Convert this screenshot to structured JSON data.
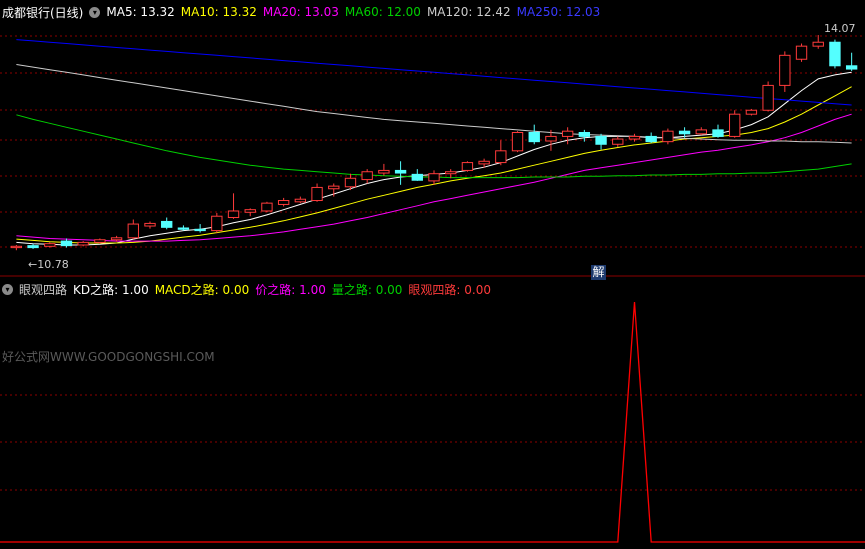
{
  "main_header": {
    "stock": "成都银行(日线)",
    "ma5": "MA5: 13.32",
    "ma10": "MA10: 13.32",
    "ma20": "MA20: 13.03",
    "ma60": "MA60: 12.00",
    "ma120": "MA120: 12.42",
    "ma250": "MA250: 12.03"
  },
  "sub_header": {
    "indicator": "眼观四路",
    "kd": "KD之路: 1.00",
    "macd": "MACD之路: 0.00",
    "price": "价之路: 1.00",
    "volume": "量之路: 0.00",
    "final": "眼观四路: 0.00"
  },
  "watermark": "好公式网WWW.GOODGONGSHI.COM",
  "jie_badge": "解",
  "price_labels": {
    "low": "←10.78",
    "high": "14.07"
  },
  "colors": {
    "up": "#ff3b3b",
    "down": "#54ffff",
    "ma5": "#ffffff",
    "ma10": "#ffff00",
    "ma20": "#ff00ff",
    "ma60": "#00d000",
    "ma120": "#cccccc",
    "ma250": "#0000ff",
    "indicator": "#ff0000",
    "grid": "#8b0000"
  },
  "chart_data": {
    "type": "candlestick",
    "y_range": [
      10.6,
      14.3
    ],
    "candles": [
      [
        10.82,
        10.86,
        10.78,
        10.84
      ],
      [
        10.85,
        10.88,
        10.8,
        10.82
      ],
      [
        10.84,
        10.9,
        10.82,
        10.88
      ],
      [
        10.92,
        10.96,
        10.82,
        10.85
      ],
      [
        10.86,
        10.92,
        10.84,
        10.9
      ],
      [
        10.9,
        10.96,
        10.88,
        10.94
      ],
      [
        10.94,
        11.0,
        10.91,
        10.97
      ],
      [
        10.97,
        11.25,
        10.95,
        11.18
      ],
      [
        11.15,
        11.22,
        11.11,
        11.19
      ],
      [
        11.22,
        11.28,
        11.1,
        11.13
      ],
      [
        11.12,
        11.16,
        11.08,
        11.1
      ],
      [
        11.1,
        11.18,
        11.05,
        11.08
      ],
      [
        11.08,
        11.35,
        11.04,
        11.3
      ],
      [
        11.28,
        11.65,
        11.26,
        11.38
      ],
      [
        11.36,
        11.42,
        11.3,
        11.4
      ],
      [
        11.38,
        11.52,
        11.36,
        11.5
      ],
      [
        11.48,
        11.58,
        11.45,
        11.54
      ],
      [
        11.52,
        11.6,
        11.5,
        11.56
      ],
      [
        11.54,
        11.8,
        11.52,
        11.74
      ],
      [
        11.72,
        11.8,
        11.6,
        11.76
      ],
      [
        11.75,
        11.95,
        11.7,
        11.88
      ],
      [
        11.86,
        12.02,
        11.8,
        11.98
      ],
      [
        11.96,
        12.1,
        11.92,
        12.0
      ],
      [
        12.0,
        12.14,
        11.78,
        11.96
      ],
      [
        11.94,
        12.02,
        11.84,
        11.85
      ],
      [
        11.84,
        12.0,
        11.78,
        11.95
      ],
      [
        11.95,
        12.02,
        11.88,
        11.98
      ],
      [
        12.0,
        12.14,
        11.98,
        12.12
      ],
      [
        12.1,
        12.18,
        12.04,
        12.14
      ],
      [
        12.12,
        12.46,
        12.08,
        12.3
      ],
      [
        12.3,
        12.6,
        12.28,
        12.58
      ],
      [
        12.58,
        12.7,
        12.4,
        12.44
      ],
      [
        12.45,
        12.62,
        12.3,
        12.52
      ],
      [
        12.52,
        12.66,
        12.4,
        12.6
      ],
      [
        12.58,
        12.62,
        12.44,
        12.52
      ],
      [
        12.52,
        12.56,
        12.32,
        12.4
      ],
      [
        12.4,
        12.52,
        12.36,
        12.48
      ],
      [
        12.48,
        12.56,
        12.44,
        12.52
      ],
      [
        12.52,
        12.58,
        12.42,
        12.44
      ],
      [
        12.44,
        12.64,
        12.4,
        12.6
      ],
      [
        12.6,
        12.66,
        12.5,
        12.56
      ],
      [
        12.56,
        12.66,
        12.54,
        12.62
      ],
      [
        12.62,
        12.7,
        12.5,
        12.52
      ],
      [
        12.52,
        12.92,
        12.5,
        12.86
      ],
      [
        12.86,
        12.94,
        12.84,
        12.92
      ],
      [
        12.92,
        13.36,
        12.9,
        13.3
      ],
      [
        13.3,
        13.82,
        13.2,
        13.76
      ],
      [
        13.7,
        13.94,
        13.66,
        13.9
      ],
      [
        13.9,
        14.07,
        13.86,
        13.96
      ],
      [
        13.96,
        14.0,
        13.56,
        13.6
      ],
      [
        13.6,
        13.8,
        13.52,
        13.55
      ]
    ],
    "ma_series": [
      {
        "name": "MA5",
        "values": [
          10.9,
          10.88,
          10.87,
          10.86,
          10.86,
          10.87,
          10.89,
          10.95,
          11.0,
          11.04,
          11.08,
          11.1,
          11.14,
          11.2,
          11.25,
          11.32,
          11.4,
          11.48,
          11.56,
          11.64,
          11.72,
          11.8,
          11.86,
          11.9,
          11.92,
          11.94,
          11.96,
          12.0,
          12.05,
          12.12,
          12.22,
          12.32,
          12.4,
          12.46,
          12.5,
          12.52,
          12.52,
          12.52,
          12.5,
          12.5,
          12.52,
          12.54,
          12.56,
          12.62,
          12.7,
          12.82,
          13.02,
          13.22,
          13.4,
          13.46,
          13.5
        ]
      },
      {
        "name": "MA10",
        "values": [
          10.95,
          10.93,
          10.91,
          10.9,
          10.89,
          10.89,
          10.89,
          10.9,
          10.92,
          10.95,
          10.98,
          11.01,
          11.05,
          11.09,
          11.13,
          11.18,
          11.23,
          11.29,
          11.35,
          11.42,
          11.49,
          11.56,
          11.62,
          11.68,
          11.74,
          11.79,
          11.84,
          11.88,
          11.92,
          11.96,
          12.02,
          12.08,
          12.14,
          12.2,
          12.26,
          12.31,
          12.35,
          12.39,
          12.42,
          12.45,
          12.48,
          12.5,
          12.52,
          12.54,
          12.58,
          12.64,
          12.74,
          12.86,
          13.0,
          13.14,
          13.28
        ]
      },
      {
        "name": "MA20",
        "values": [
          11.0,
          10.98,
          10.96,
          10.95,
          10.94,
          10.93,
          10.92,
          10.92,
          10.92,
          10.92,
          10.93,
          10.94,
          10.96,
          10.98,
          11.0,
          11.03,
          11.06,
          11.1,
          11.14,
          11.18,
          11.23,
          11.28,
          11.34,
          11.4,
          11.46,
          11.52,
          11.57,
          11.62,
          11.67,
          11.72,
          11.77,
          11.82,
          11.88,
          11.94,
          12.0,
          12.04,
          12.08,
          12.12,
          12.16,
          12.2,
          12.24,
          12.28,
          12.31,
          12.35,
          12.39,
          12.44,
          12.5,
          12.58,
          12.68,
          12.78,
          12.86
        ]
      },
      {
        "name": "MA60",
        "values": [
          12.85,
          12.78,
          12.72,
          12.66,
          12.6,
          12.54,
          12.48,
          12.42,
          12.36,
          12.3,
          12.25,
          12.2,
          12.16,
          12.12,
          12.08,
          12.05,
          12.02,
          12.0,
          11.98,
          11.96,
          11.94,
          11.93,
          11.92,
          11.91,
          11.9,
          11.9,
          11.89,
          11.89,
          11.89,
          11.89,
          11.89,
          11.9,
          11.9,
          11.9,
          11.91,
          11.91,
          11.92,
          11.92,
          11.93,
          11.93,
          11.94,
          11.94,
          11.95,
          11.95,
          11.96,
          11.96,
          11.98,
          12.0,
          12.02,
          12.06,
          12.1
        ]
      },
      {
        "name": "MA120",
        "values": [
          13.62,
          13.58,
          13.54,
          13.5,
          13.46,
          13.42,
          13.38,
          13.34,
          13.3,
          13.26,
          13.22,
          13.18,
          13.14,
          13.1,
          13.06,
          13.02,
          12.98,
          12.94,
          12.9,
          12.87,
          12.84,
          12.81,
          12.78,
          12.76,
          12.74,
          12.72,
          12.7,
          12.68,
          12.66,
          12.64,
          12.62,
          12.6,
          12.58,
          12.56,
          12.55,
          12.54,
          12.53,
          12.52,
          12.51,
          12.5,
          12.49,
          12.48,
          12.47,
          12.46,
          12.46,
          12.45,
          12.45,
          12.44,
          12.44,
          12.43,
          12.42
        ]
      },
      {
        "name": "MA250",
        "values": [
          14.0,
          13.98,
          13.96,
          13.94,
          13.92,
          13.9,
          13.88,
          13.86,
          13.84,
          13.82,
          13.8,
          13.78,
          13.76,
          13.74,
          13.72,
          13.7,
          13.68,
          13.66,
          13.64,
          13.62,
          13.6,
          13.58,
          13.56,
          13.54,
          13.52,
          13.5,
          13.48,
          13.46,
          13.44,
          13.42,
          13.4,
          13.38,
          13.36,
          13.34,
          13.32,
          13.3,
          13.28,
          13.26,
          13.24,
          13.22,
          13.2,
          13.18,
          13.16,
          13.14,
          13.12,
          13.1,
          13.08,
          13.06,
          13.04,
          13.02,
          13.0
        ]
      }
    ],
    "indicator_series": {
      "name": "眼观四路",
      "values": [
        0,
        0,
        0,
        0,
        0,
        0,
        0,
        0,
        0,
        0,
        0,
        0,
        0,
        0,
        0,
        0,
        0,
        0,
        0,
        0,
        0,
        0,
        0,
        0,
        0,
        0,
        0,
        0,
        0,
        0,
        0,
        0,
        0,
        0,
        0,
        0,
        0,
        1,
        0,
        0,
        0,
        0,
        0,
        0,
        0,
        0,
        0,
        0,
        0,
        0,
        0
      ]
    }
  }
}
